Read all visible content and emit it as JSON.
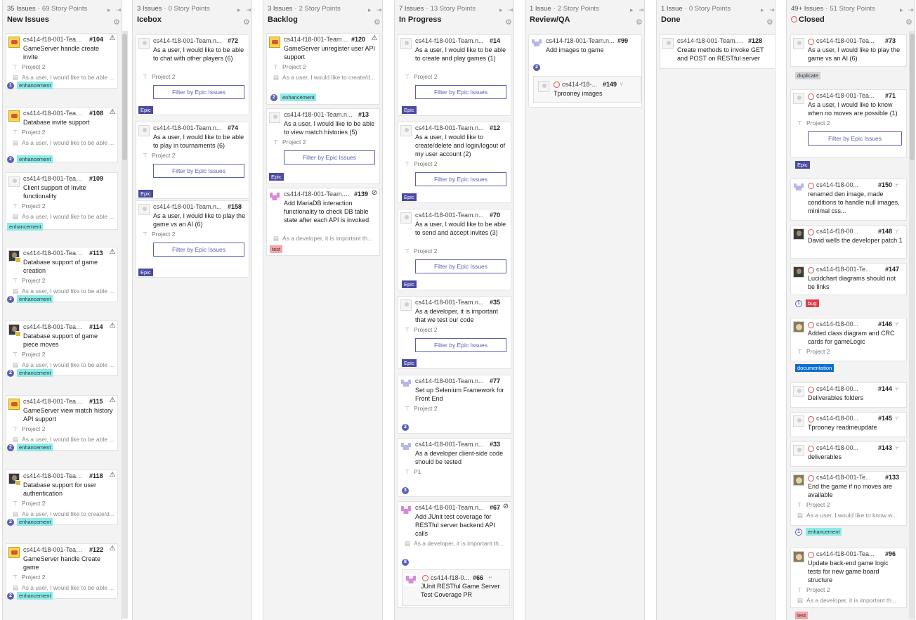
{
  "columns": [
    {
      "issues": "35 Issues",
      "points": "69 Story Points",
      "title": "New Issues"
    },
    {
      "issues": "3 Issues",
      "points": "0 Story Points",
      "title": "Icebox"
    },
    {
      "issues": "3 Issues",
      "points": "2 Story Points",
      "title": "Backlog"
    },
    {
      "issues": "7 Issues",
      "points": "13 Story Points",
      "title": "In Progress"
    },
    {
      "issues": "1 Issue",
      "points": "2 Story Points",
      "title": "Review/QA"
    },
    {
      "issues": "1 Issue",
      "points": "0 Story Points",
      "title": "Done"
    },
    {
      "issues": "49+ Issues",
      "points": "51 Story Points",
      "title": "Closed"
    }
  ],
  "common": {
    "repo": "cs414-f18-001-Team.n...",
    "project": "Project 2",
    "filter_epic": "Filter by Epic Issues",
    "dot": "·"
  },
  "labels": {
    "enhancement": "enhancement",
    "epic": "Epic",
    "duplicate": "duplicate",
    "bug": "bug",
    "documentation": "documentation",
    "test": "test"
  },
  "new_issues": [
    {
      "num": "#104",
      "title": "GameServer handle create invite",
      "desc": "As a user, I would like to be able ...",
      "est": "1"
    },
    {
      "num": "#108",
      "title": "Database invite support",
      "desc": "As a user, I would like to be able ...",
      "est": "2"
    },
    {
      "num": "#109",
      "title": "Client support of Invite functionality",
      "desc": "As a user, I would like to be able ..."
    },
    {
      "num": "#113",
      "title": "Database support of game creation",
      "desc": "As a user, I would like to be able ...",
      "est": "2"
    },
    {
      "num": "#114",
      "title": "Database support of game piece moves",
      "desc": "As a user, I would like to be able ...",
      "est": "2"
    },
    {
      "num": "#115",
      "title": "GameServer view match history API support",
      "desc": "As a user, I would like to be able ...",
      "est": "2"
    },
    {
      "num": "#118",
      "title": "Database support for user authentication",
      "desc": "As a user, I would like to create/d...",
      "est": "2"
    },
    {
      "num": "#122",
      "title": "GameServer handle Create game",
      "desc": "As a user, I would like to be able ...",
      "est": "2"
    }
  ],
  "icebox": [
    {
      "num": "#72",
      "title": "As a user, I would like to be able to chat with other players (6)"
    },
    {
      "num": "#74",
      "title": "As a user, I would like to be able to play in tournaments (6)"
    },
    {
      "num": "#158",
      "title": "As a user, I would like to play the game vs an AI (6)"
    }
  ],
  "backlog": [
    {
      "num": "#120",
      "title": "GameServer unregister user API support",
      "desc": "As a user, I would like to create/d...",
      "est": "2"
    },
    {
      "num": "#13",
      "title": "As a user, I would like to be able to view match histories (5)"
    },
    {
      "num": "#139",
      "title": "Add MariaDB interaction functionality to check DB table state after each API is invoked",
      "desc": "As a developer, it is important th..."
    }
  ],
  "in_progress": [
    {
      "num": "#14",
      "title": "As a user, I would like to be able to create and play games (1)"
    },
    {
      "num": "#12",
      "title": "As a user, I would like to create/delete and login/logout of my user account (2)"
    },
    {
      "num": "#70",
      "title": "As a user, I would like to be able to send and accept invites (3)"
    },
    {
      "num": "#35",
      "title": "As a developer, it is important that we test our code"
    },
    {
      "num": "#77",
      "title": "Set up Selenium Framework for Front End",
      "est": "2"
    },
    {
      "num": "#33",
      "title": "As a developer client-side code should be tested",
      "proj": "P1",
      "est": "3"
    },
    {
      "num": "#67",
      "title": "Add JUnit test coverage for RESTful server backend API calls",
      "desc": "As a developer, it is important th...",
      "est": "8"
    }
  ],
  "ip_sub": {
    "repo": "cs414-f18-0...",
    "num": "#66",
    "title": "JUnit RESTful Game Server Test Coverage PR"
  },
  "review": {
    "num": "#99",
    "title": "Add images to game",
    "est": "2",
    "sub": {
      "repo": "cs414-f18-...",
      "num": "#149",
      "title": "Tprooney images"
    }
  },
  "done": {
    "num": "#128",
    "title": "Create methods to invoke GET and POST on RESTful server"
  },
  "closed": [
    {
      "repo": "cs414-f18-001-Tea...",
      "num": "#73",
      "title": "As a user, I would like to play the game vs an AI (6)"
    },
    {
      "repo": "cs414-f18-001-Tea...",
      "num": "#71",
      "title": "As a user, I would like to know when no moves are possible (1)"
    },
    {
      "repo": "cs414-f18-00...",
      "num": "#150",
      "title": "renamed den image, made conditions to handle null images, minimal css..."
    },
    {
      "repo": "cs414-f18-00...",
      "num": "#148",
      "title": "David wells the developer patch 1"
    },
    {
      "repo": "cs414-f18-001-Te...",
      "num": "#147",
      "title": "Lucidchart diagrams should not be links",
      "est": "1"
    },
    {
      "repo": "cs414-f18-00...",
      "num": "#146",
      "title": "Added class diagram and CRC cards for gameLogic"
    },
    {
      "repo": "cs414-f18-00...",
      "num": "#144",
      "title": "Deliverables folders"
    },
    {
      "repo": "cs414-f18-00...",
      "num": "#145",
      "title": "Tprooney readmeupdate"
    },
    {
      "repo": "cs414-f18-00...",
      "num": "#143",
      "title": "deliverables"
    },
    {
      "repo": "cs414-f18-001-Te...",
      "num": "#133",
      "title": "End the game if no moves are available",
      "desc": "As a user, I would like to know w...",
      "est": "1"
    },
    {
      "repo": "cs414-f18-001-Tea...",
      "num": "#96",
      "title": "Update back-end game logic tests for new game board structure",
      "desc": "As a developer, it is important th..."
    }
  ]
}
